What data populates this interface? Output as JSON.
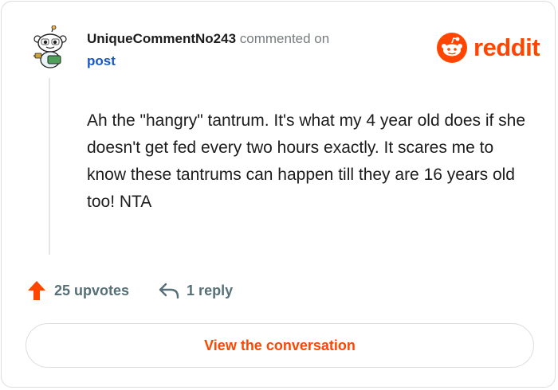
{
  "comment": {
    "username": "UniqueCommentNo243",
    "action_text": "commented on",
    "post_link": "post",
    "body": "Ah the \"hangry\" tantrum. It's what my 4 year old does if she doesn't get fed every two hours exactly. It scares me to know these tantrums can happen till they are 16 years old too! NTA",
    "upvotes_label": "25 upvotes",
    "replies_label": "1 reply"
  },
  "brand": {
    "wordmark": "reddit",
    "color": "#ff4500"
  },
  "cta": {
    "label": "View the conversation"
  },
  "icons": {
    "avatar": "snoo-avatar-icon",
    "logo": "reddit-logo-icon",
    "upvote": "upvote-arrow-icon",
    "reply": "reply-arrow-icon"
  },
  "colors": {
    "accent": "#ff4500",
    "link": "#1a56c4",
    "muted": "#576f76",
    "text": "#1c1c1c"
  }
}
